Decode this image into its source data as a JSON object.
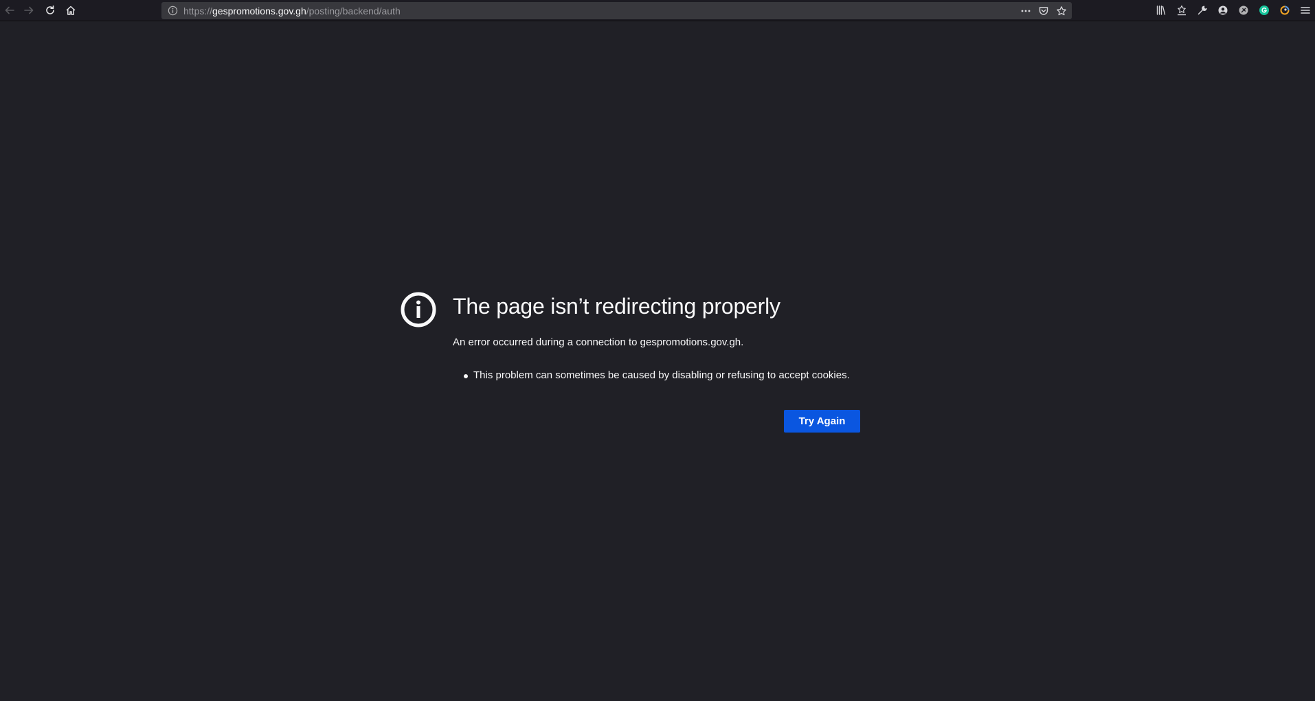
{
  "toolbar": {
    "back_icon": "arrow-left-icon",
    "forward_icon": "arrow-right-icon",
    "reload_icon": "reload-icon",
    "home_icon": "home-icon"
  },
  "urlbar": {
    "scheme": "https://",
    "host": "gespromotions.gov.gh",
    "path": "/posting/backend/auth",
    "page_actions_icon": "ellipsis-icon",
    "pocket_icon": "pocket-icon",
    "bookmark_icon": "star-icon"
  },
  "extensions": [
    "library-icon",
    "downloads-icon",
    "wrench-icon",
    "account-icon",
    "extension-icon",
    "grammarly-icon",
    "color-picker-icon",
    "menu-icon"
  ],
  "colors": {
    "page_bg": "#202026",
    "button_bg": "#0a56e0",
    "grammarly": "#15c39a"
  },
  "error": {
    "title": "The page isn’t redirecting properly",
    "description": "An error occurred during a connection to gespromotions.gov.gh.",
    "bullets": [
      "This problem can sometimes be caused by disabling or refusing to accept cookies."
    ],
    "try_again_label": "Try Again"
  }
}
